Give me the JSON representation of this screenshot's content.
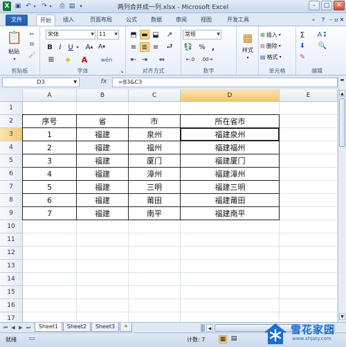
{
  "title": "两列合并成一列.xlsx - Microsoft Excel",
  "tabs": [
    {
      "label": "文件",
      "style": "file"
    },
    {
      "label": "开始",
      "style": "active"
    },
    {
      "label": "插入",
      "style": ""
    },
    {
      "label": "页面布局",
      "style": ""
    },
    {
      "label": "公式",
      "style": ""
    },
    {
      "label": "数据",
      "style": ""
    },
    {
      "label": "审阅",
      "style": ""
    },
    {
      "label": "视图",
      "style": ""
    },
    {
      "label": "开发工具",
      "style": ""
    }
  ],
  "ribbon": {
    "paste_label": "粘贴",
    "clipboard_label": "剪贴板",
    "font_name": "宋体",
    "font_size": "11",
    "font_group_label": "字体",
    "align_group_label": "对齐方式",
    "number_format": "常规",
    "number_group_label": "数字",
    "style_label": "样式",
    "insert_label": "插入",
    "delete_label": "删除",
    "format_label": "格式",
    "cells_group_label": "单元格",
    "editing_group_label": "编辑",
    "percent": "%",
    "comma": ","
  },
  "namebox": "D3",
  "fx": "fx",
  "formula": "=B3&C3",
  "columns": [
    "A",
    "B",
    "C",
    "D",
    "E"
  ],
  "rows": [
    "1",
    "2",
    "3",
    "4",
    "5",
    "6",
    "7",
    "8",
    "9",
    "10",
    "11",
    "12",
    "13",
    "14",
    "15",
    "16",
    "17"
  ],
  "table": {
    "header": [
      "序号",
      "省",
      "市",
      "所在省市"
    ],
    "rows": [
      [
        "1",
        "福建",
        "泉州",
        "福建泉州"
      ],
      [
        "2",
        "福建",
        "福州",
        "福建福州"
      ],
      [
        "3",
        "福建",
        "厦门",
        "福建厦门"
      ],
      [
        "4",
        "福建",
        "漳州",
        "福建漳州"
      ],
      [
        "5",
        "福建",
        "三明",
        "福建三明"
      ],
      [
        "6",
        "福建",
        "莆田",
        "福建莆田"
      ],
      [
        "7",
        "福建",
        "南平",
        "福建南平"
      ]
    ]
  },
  "sheets": [
    "Sheet1",
    "Sheet2",
    "Sheet3"
  ],
  "status": {
    "ready": "就绪",
    "count": "计数: 7"
  },
  "watermark": {
    "name": "雪花家园",
    "url": "www.xhjaty.com"
  },
  "colors": {
    "file_tab": "#2c6ec6",
    "accent": "#1e5fb8"
  }
}
